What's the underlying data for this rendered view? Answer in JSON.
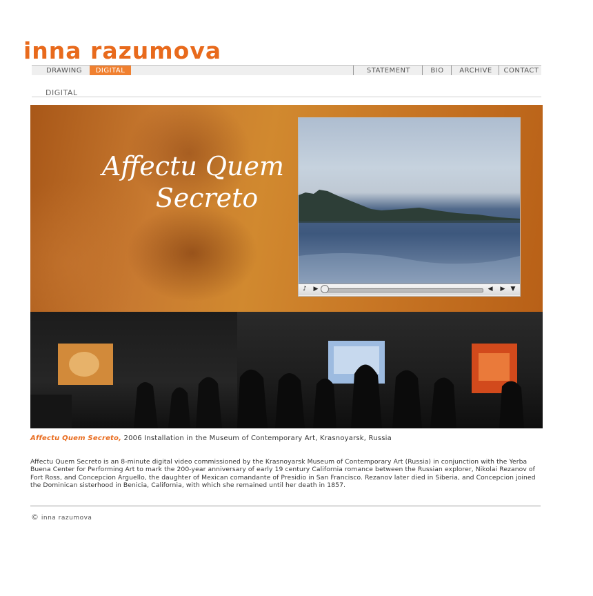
{
  "site": {
    "logo_text": "inna razumova"
  },
  "nav": {
    "left": [
      {
        "label": "DRAWING",
        "active": false
      },
      {
        "label": "DIGITAL",
        "active": true
      }
    ],
    "right": [
      {
        "label": "STATEMENT"
      },
      {
        "label": "BIO"
      },
      {
        "label": "ARCHIVE"
      },
      {
        "label": "CONTACT"
      }
    ]
  },
  "section": {
    "title": "DIGITAL"
  },
  "hero": {
    "title_line1": "Affectu Quem",
    "title_line2": "Secreto",
    "video_controls": {
      "volume": "volume-icon",
      "play": "play-icon",
      "rewind": "rewind-icon",
      "forward": "forward-icon",
      "menu": "menu-down-icon"
    }
  },
  "caption": {
    "title": "Affectu Quem Secreto,",
    "text": " 2006 Installation in the Museum of Contemporary Art, Krasnoyarsk, Russia"
  },
  "description": "Affectu Quem Secreto is an 8-minute digital video commissioned by the Krasnoyarsk Museum of Contemporary Art (Russia) in conjunction with the Yerba Buena Center for Performing Art to mark the 200-year anniversary of early 19 century California romance between the Russian explorer, Nikolai Rezanov of Fort Ross, and Concepcion Arguello, the daughter of Mexican comandante of Presidio in San Francisco. Rezanov later died in Siberia, and Concepcion joined the Dominican sisterhood in Benicia, California, with which she remained until her death in 1857.",
  "footer": {
    "copyright_symbol": "©",
    "text": "inna razumova"
  },
  "colors": {
    "accent": "#e86a1c",
    "nav_bg": "#efefef"
  }
}
